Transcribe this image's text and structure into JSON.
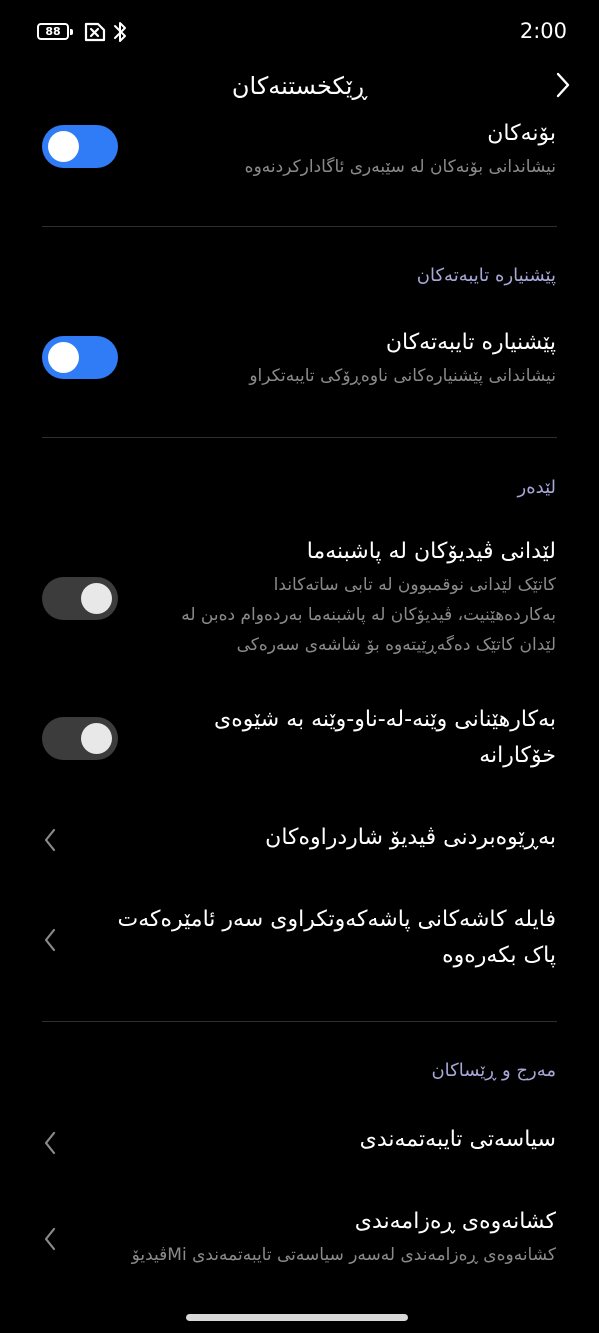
{
  "status_bar": {
    "battery": "88",
    "time": "2:00"
  },
  "header": {
    "title": "ڕێکخستنەکان"
  },
  "notifications": {
    "title": "بۆنەکان",
    "subtitle": "نیشاندانی بۆنەکان لە سێبەری ئاگادارکردنەوە",
    "enabled": true
  },
  "recommendations_section": {
    "header": "پێشنیارە تایبەتەکان",
    "title": "پێشنیارە تایبەتەکان",
    "subtitle": "نیشاندانی پێشنیارەکانی ناوەڕۆکی تایبەتکراو",
    "enabled": true
  },
  "player_section": {
    "header": "لێدەر",
    "background_play": {
      "title": "لێدانی ڤیدیۆکان لە پاشبنەما",
      "subtitle_lines": [
        "کاتێک لێدانی نوقمبوون لە تابی ساتەکاندا",
        "بەکاردەهێنیت، ڤیدیۆکان لە پاشبنەما بەردەوام دەبن لە",
        "لێدان کاتێک دەگەڕێیتەوە بۆ شاشەی سەرەکی"
      ],
      "enabled": false
    },
    "pip": {
      "title_lines": [
        "بەکارهێنانی وێنە-لە-ناو-وێنە بە شێوەی",
        "خۆکارانە"
      ],
      "enabled": false
    },
    "manage_hidden": {
      "title": "بەڕێوەبردنی ڤیدیۆ شاردراوەکان"
    },
    "clear_cache": {
      "title_lines": [
        "فایلە کاشەکانی پاشەکەوتکراوی سەر ئامێرەکەت",
        "پاک بکەرەوە"
      ]
    }
  },
  "terms_section": {
    "header": "مەرج و ڕێساکان",
    "privacy_policy": {
      "title": "سیاسەتی تایبەتمەندی"
    },
    "privacy_settings": {
      "title": "کشانەوەی ڕەزامەندی",
      "subtitle": "کشانەوەی ڕەزامەندی لەسەر سیاسەتی تایبەتمەندی Miڤیدیۆ"
    }
  }
}
